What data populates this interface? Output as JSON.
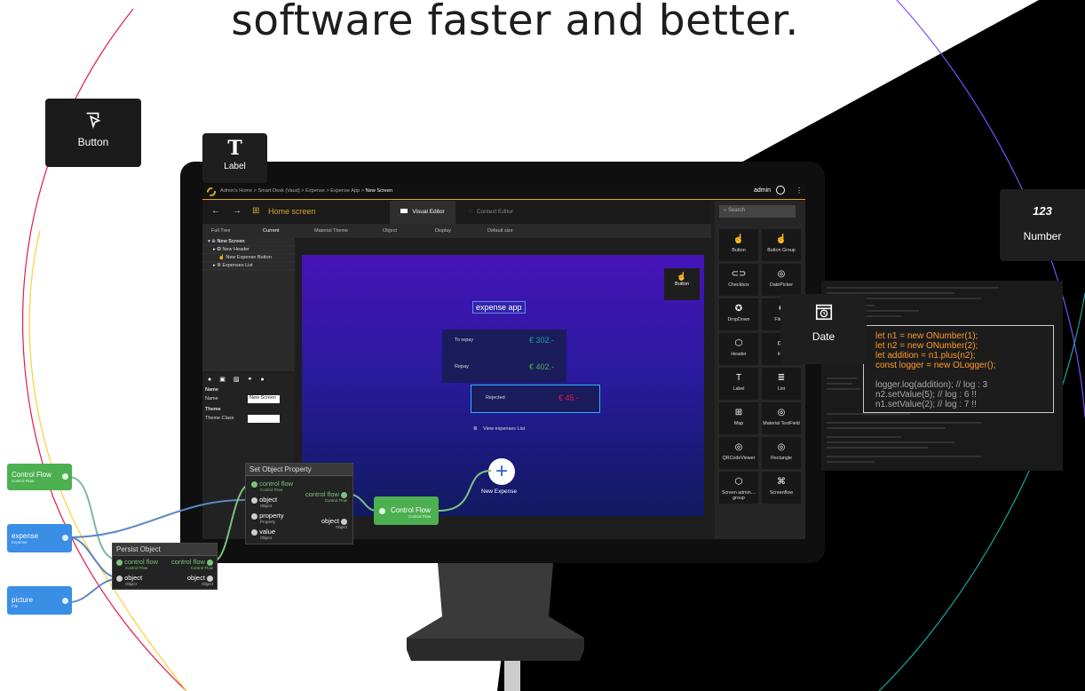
{
  "headline": "software faster and better.",
  "floating_cards": {
    "button": {
      "label": "Button",
      "icon": "pointer-click-icon"
    },
    "label": {
      "label": "Label",
      "glyph": "T"
    },
    "number": {
      "label": "Number",
      "glyph": "123"
    },
    "date": {
      "label": "Date",
      "icon": "calendar-clock-icon"
    }
  },
  "app": {
    "breadcrumb": [
      "Admin's Home",
      "Smart Desk (Vaud)",
      "Expense",
      "Expense App",
      "New Screen"
    ],
    "separator": ">",
    "user": "admin",
    "screen_title": "Home screen",
    "tabs": {
      "visual": "Visual Editor",
      "context": "Context Editor"
    },
    "search_placeholder": "Search",
    "subbar": {
      "full_tree": "Full Tree",
      "current": "Current",
      "material_theme": "Material Theme",
      "object": "Object",
      "display": "Display",
      "size": "Default size"
    },
    "tree": {
      "root": "New Screen",
      "items": [
        "New Header",
        "New Expense Button",
        "Expenses List"
      ]
    },
    "props": {
      "section_name": "Name",
      "name_label": "Name",
      "name_value": "New Screen",
      "theme_section": "Theme",
      "theme_class_label": "Theme Class"
    },
    "canvas": {
      "app_title": "expense app",
      "rows": [
        {
          "label": "To repay",
          "value": "€ 302.-"
        },
        {
          "label": "Repay",
          "value": "€ 402.-"
        },
        {
          "label": "Rejected",
          "value": "€ 45.-"
        }
      ],
      "view_list": "View expenses List",
      "fab_label": "New Expense",
      "widget_label": "Button"
    },
    "palette": [
      {
        "label": "Button",
        "glyph": "☝"
      },
      {
        "label": "Button Group",
        "glyph": "☝"
      },
      {
        "label": "Checkbox",
        "glyph": "⊂⊃"
      },
      {
        "label": "DatePicker",
        "glyph": "◎"
      },
      {
        "label": "DropDown",
        "glyph": "✪"
      },
      {
        "label": "FileUp",
        "glyph": "€"
      },
      {
        "label": "Header",
        "glyph": "⬡"
      },
      {
        "label": "Ima",
        "glyph": "▭"
      },
      {
        "label": "Label",
        "glyph": "T"
      },
      {
        "label": "List",
        "glyph": "≣"
      },
      {
        "label": "Map",
        "glyph": "⊞"
      },
      {
        "label": "Material TextField",
        "glyph": "◎"
      },
      {
        "label": "QRCodeViewer",
        "glyph": "◎"
      },
      {
        "label": "Rectangle",
        "glyph": "◎"
      },
      {
        "label": "Screen admin… group",
        "glyph": "⬡"
      },
      {
        "label": "Screenflow",
        "glyph": "⌘"
      }
    ]
  },
  "nodes": {
    "control_flow": {
      "label": "Control Flow",
      "sub": "Control Flow"
    },
    "expense": {
      "label": "expense",
      "sub": "Expense"
    },
    "picture": {
      "label": "picture",
      "sub": "File"
    },
    "control_flow_out": {
      "label": "Control Flow",
      "sub": "Control Flow"
    },
    "set_object": {
      "title": "Set Object Property",
      "inputs": [
        {
          "label": "control flow",
          "sub": "Control Flow"
        },
        {
          "label": "object",
          "sub": "Object"
        },
        {
          "label": "property",
          "sub": "Property"
        },
        {
          "label": "value",
          "sub": "Object"
        }
      ],
      "outputs": [
        {
          "label": "control flow",
          "sub": "Control Flow"
        },
        {
          "label": "object",
          "sub": "Object"
        }
      ]
    },
    "persist": {
      "title": "Persist Object",
      "inputs": [
        {
          "label": "control flow",
          "sub": "Control Flow"
        },
        {
          "label": "object",
          "sub": "Object"
        }
      ],
      "outputs": [
        {
          "label": "control flow",
          "sub": "Control Flow"
        },
        {
          "label": "object",
          "sub": "Object"
        }
      ]
    }
  },
  "code": {
    "lines": [
      "let n1 = new ONumber(1);",
      "let n2 = new ONumber(2);",
      "let addition = n1.plus(n2);",
      "const logger = new OLogger();",
      "",
      "logger.log(addition); // log : 3",
      "n2.setValue(5); // log : 6 !!",
      "n1.setValue(2); // log : 7 !!"
    ]
  },
  "colors": {
    "accent": "#d7a82b",
    "node_green": "#4caf50",
    "node_blue": "#3a8ee6",
    "teal": "#18a8a0",
    "red": "#e8184a"
  }
}
